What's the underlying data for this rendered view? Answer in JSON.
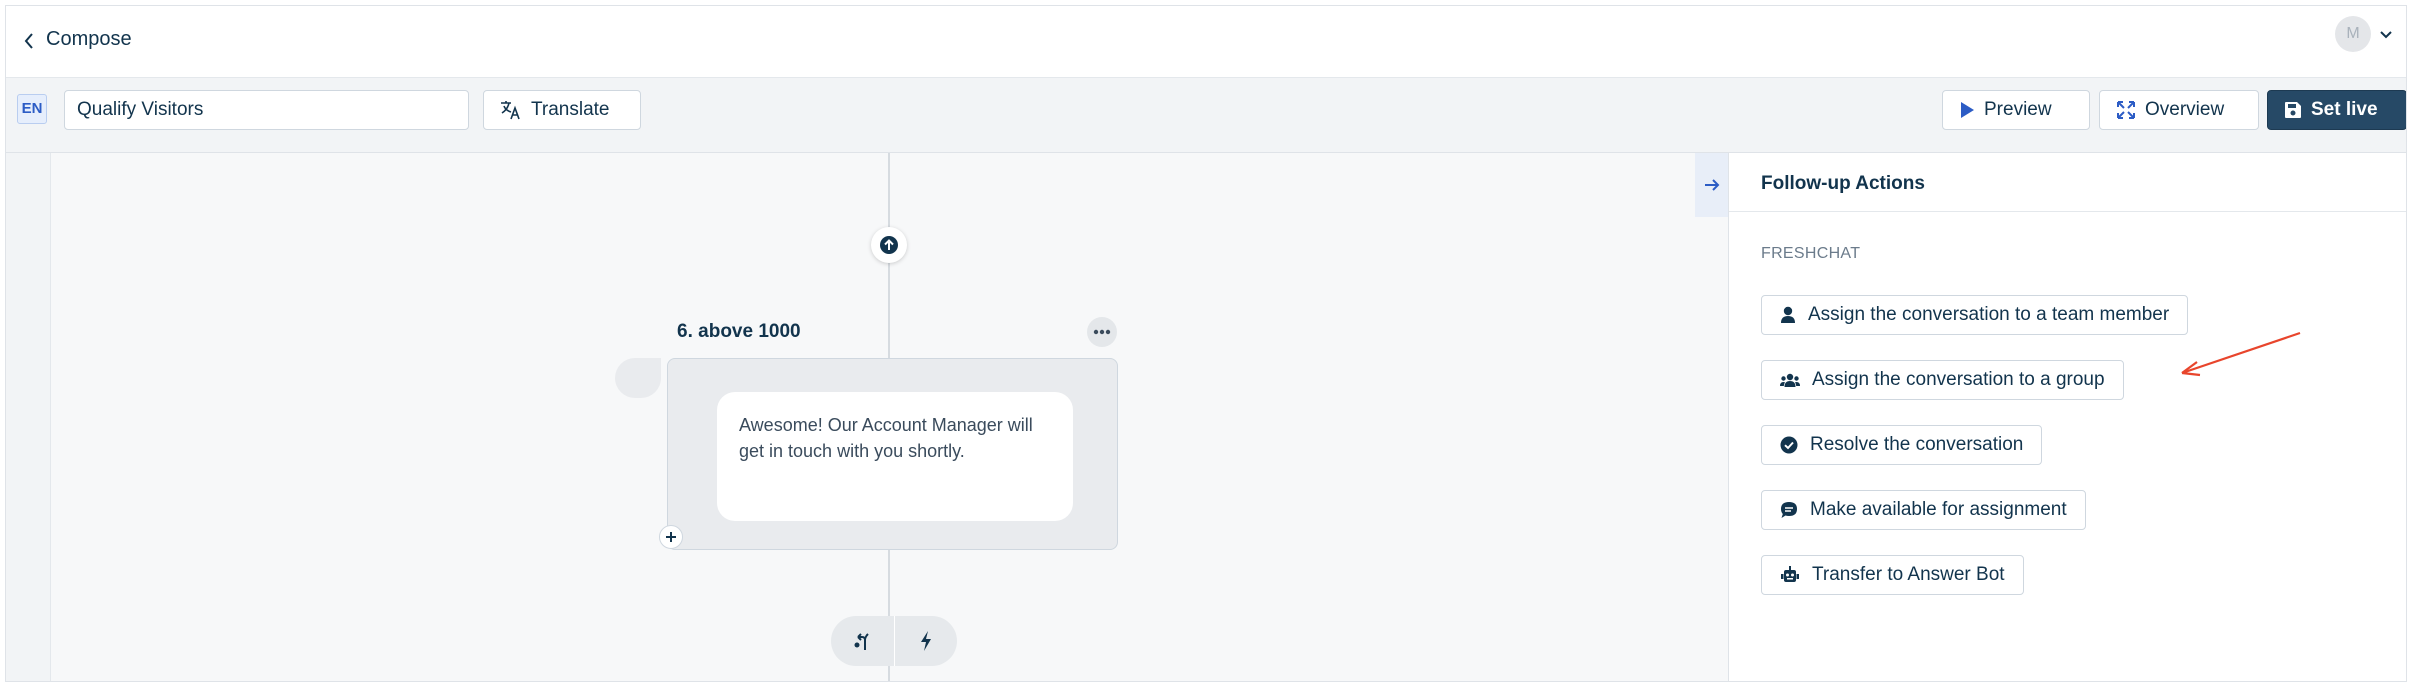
{
  "header": {
    "title": "Compose",
    "avatar_initial": "M"
  },
  "toolbar": {
    "language_code": "EN",
    "flow_name": "Qualify Visitors",
    "translate_label": "Translate",
    "preview_label": "Preview",
    "overview_label": "Overview",
    "set_live_label": "Set live"
  },
  "canvas": {
    "node": {
      "number": "6.",
      "title": "above 1000",
      "message": "Awesome! Our Account Manager will get in touch with you shortly."
    }
  },
  "panel": {
    "title": "Follow-up Actions",
    "section_label": "FRESHCHAT",
    "actions": [
      {
        "label": "Assign the conversation to a team member",
        "icon": "person-icon"
      },
      {
        "label": "Assign the conversation to a group",
        "icon": "group-icon"
      },
      {
        "label": "Resolve the conversation",
        "icon": "check-circle-icon"
      },
      {
        "label": "Make available for assignment",
        "icon": "chat-bubble-icon"
      },
      {
        "label": "Transfer to Answer Bot",
        "icon": "robot-icon"
      }
    ]
  },
  "colors": {
    "primary_dark": "#264966",
    "accent_blue": "#2c5cc5",
    "annotation_red": "#e8452c"
  }
}
